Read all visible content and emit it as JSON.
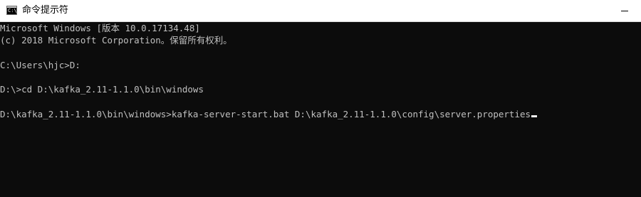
{
  "window": {
    "title": "命令提示符",
    "icon": "cmd-icon",
    "icon_glyph": "C:\\"
  },
  "console": {
    "lines": [
      "Microsoft Windows [版本 10.0.17134.48]",
      "(c) 2018 Microsoft Corporation。保留所有权利。",
      "",
      "C:\\Users\\hjc>D:",
      "",
      "D:\\>cd D:\\kafka_2.11-1.1.0\\bin\\windows",
      "",
      "D:\\kafka_2.11-1.1.0\\bin\\windows>kafka-server-start.bat D:\\kafka_2.11-1.1.0\\config\\server.properties"
    ]
  },
  "colors": {
    "console_background": "#0c0c0c",
    "console_text": "#c0c0c0",
    "titlebar_background": "#ffffff",
    "cursor": "#f2f2f2"
  }
}
